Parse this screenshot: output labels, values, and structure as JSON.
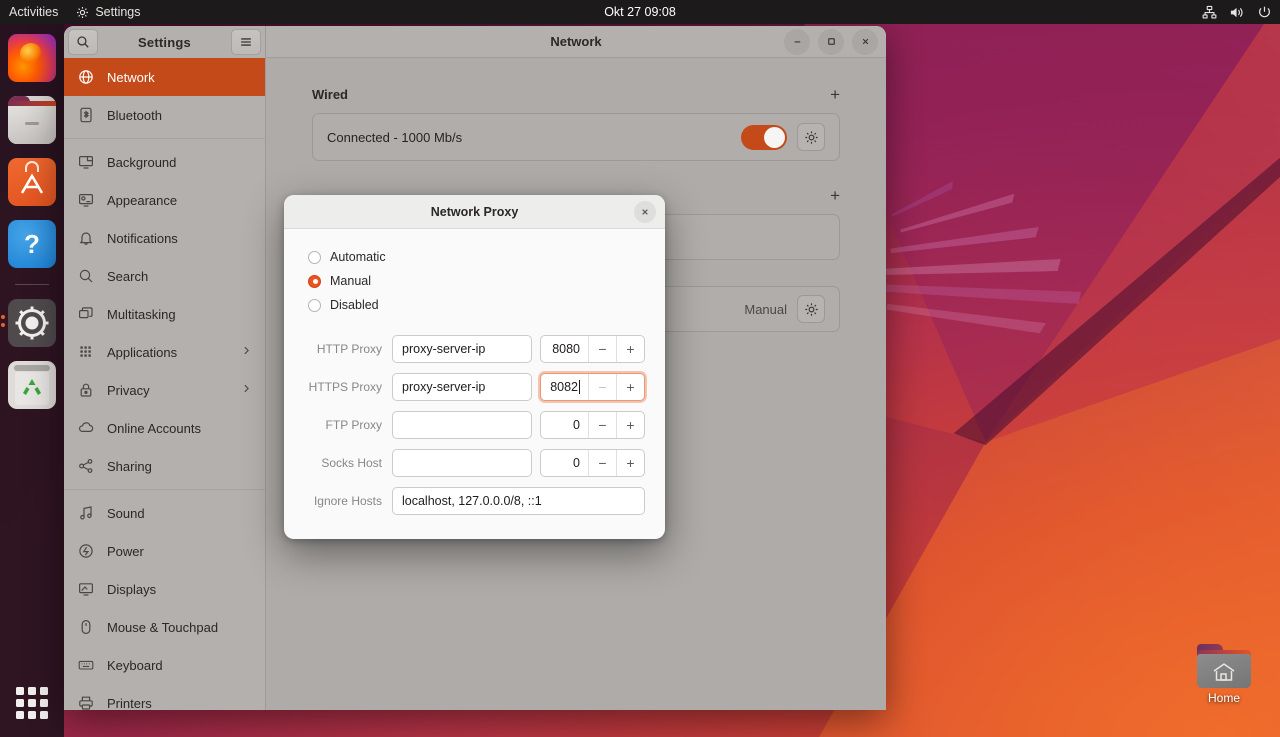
{
  "topbar": {
    "activities": "Activities",
    "app_menu": "Settings",
    "app_menu_icon": "gear-icon",
    "clock": "Okt 27  09:08",
    "tray": [
      {
        "icon": "network-wired-icon"
      },
      {
        "icon": "volume-icon"
      },
      {
        "icon": "power-icon"
      }
    ]
  },
  "dock": {
    "items": [
      {
        "name": "firefox",
        "icon": "firefox-icon"
      },
      {
        "name": "files",
        "icon": "files-icon"
      },
      {
        "name": "app-store",
        "icon": "ubuntu-software-icon"
      },
      {
        "name": "help",
        "icon": "help-icon"
      },
      {
        "name": "settings",
        "icon": "settings-gear-icon",
        "running": true
      },
      {
        "name": "trash",
        "icon": "trash-icon"
      }
    ],
    "show_apps": "show-applications-icon"
  },
  "desktop": {
    "home_icon_label": "Home",
    "home_icon": "home-folder-icon"
  },
  "settings": {
    "sidebar": {
      "title": "Settings",
      "search_icon": "search-icon",
      "menu_icon": "hamburger-menu-icon",
      "items": [
        {
          "label": "Network",
          "icon": "network-globe-icon",
          "active": true,
          "chevron": false
        },
        {
          "label": "Bluetooth",
          "icon": "bluetooth-icon",
          "active": false,
          "chevron": false
        },
        {
          "label": "Background",
          "icon": "background-icon",
          "active": false,
          "chevron": false
        },
        {
          "label": "Appearance",
          "icon": "appearance-icon",
          "active": false,
          "chevron": false
        },
        {
          "label": "Notifications",
          "icon": "bell-icon",
          "active": false,
          "chevron": false
        },
        {
          "label": "Search",
          "icon": "search-icon",
          "active": false,
          "chevron": false
        },
        {
          "label": "Multitasking",
          "icon": "multitasking-icon",
          "active": false,
          "chevron": false
        },
        {
          "label": "Applications",
          "icon": "grid-icon",
          "active": false,
          "chevron": true
        },
        {
          "label": "Privacy",
          "icon": "lock-icon",
          "active": false,
          "chevron": true
        },
        {
          "label": "Online Accounts",
          "icon": "cloud-icon",
          "active": false,
          "chevron": false
        },
        {
          "label": "Sharing",
          "icon": "share-icon",
          "active": false,
          "chevron": false
        },
        {
          "label": "Sound",
          "icon": "sound-note-icon",
          "active": false,
          "chevron": false
        },
        {
          "label": "Power",
          "icon": "power-plug-icon",
          "active": false,
          "chevron": false
        },
        {
          "label": "Displays",
          "icon": "displays-icon",
          "active": false,
          "chevron": false
        },
        {
          "label": "Mouse & Touchpad",
          "icon": "mouse-icon",
          "active": false,
          "chevron": false
        },
        {
          "label": "Keyboard",
          "icon": "keyboard-icon",
          "active": false,
          "chevron": false
        },
        {
          "label": "Printers",
          "icon": "printer-icon",
          "active": false,
          "chevron": false
        }
      ]
    },
    "window": {
      "title": "Network",
      "minimize_icon": "minimize-icon",
      "maximize_icon": "maximize-icon",
      "close_icon": "close-icon"
    },
    "network": {
      "wired_section_title": "Wired",
      "wired_add_label": "+",
      "wired_status": "Connected - 1000 Mb/s",
      "wired_toggle_on": true,
      "wired_gear_icon": "gear-icon",
      "second_section_add_label": "+",
      "proxy_value": "Manual",
      "proxy_gear_icon": "gear-icon"
    }
  },
  "proxy_dialog": {
    "title": "Network Proxy",
    "close_icon": "close-icon",
    "modes": [
      {
        "label": "Automatic",
        "selected": false
      },
      {
        "label": "Manual",
        "selected": true
      },
      {
        "label": "Disabled",
        "selected": false
      }
    ],
    "fields": [
      {
        "label": "HTTP Proxy",
        "host": "proxy-server-ip",
        "port": "8080",
        "focused": false
      },
      {
        "label": "HTTPS Proxy",
        "host": "proxy-server-ip",
        "port": "8082",
        "focused": true
      },
      {
        "label": "FTP Proxy",
        "host": "",
        "port": "0",
        "focused": false
      },
      {
        "label": "Socks Host",
        "host": "",
        "port": "0",
        "focused": false
      }
    ],
    "ignore_hosts_label": "Ignore Hosts",
    "ignore_hosts_value": "localhost, 127.0.0.0/8, ::1",
    "minus_label": "−",
    "plus_label": "+"
  },
  "colors": {
    "accent_orange": "#e95420",
    "sidebar_active": "#c44b19",
    "toggle_on": "#c44b19"
  }
}
